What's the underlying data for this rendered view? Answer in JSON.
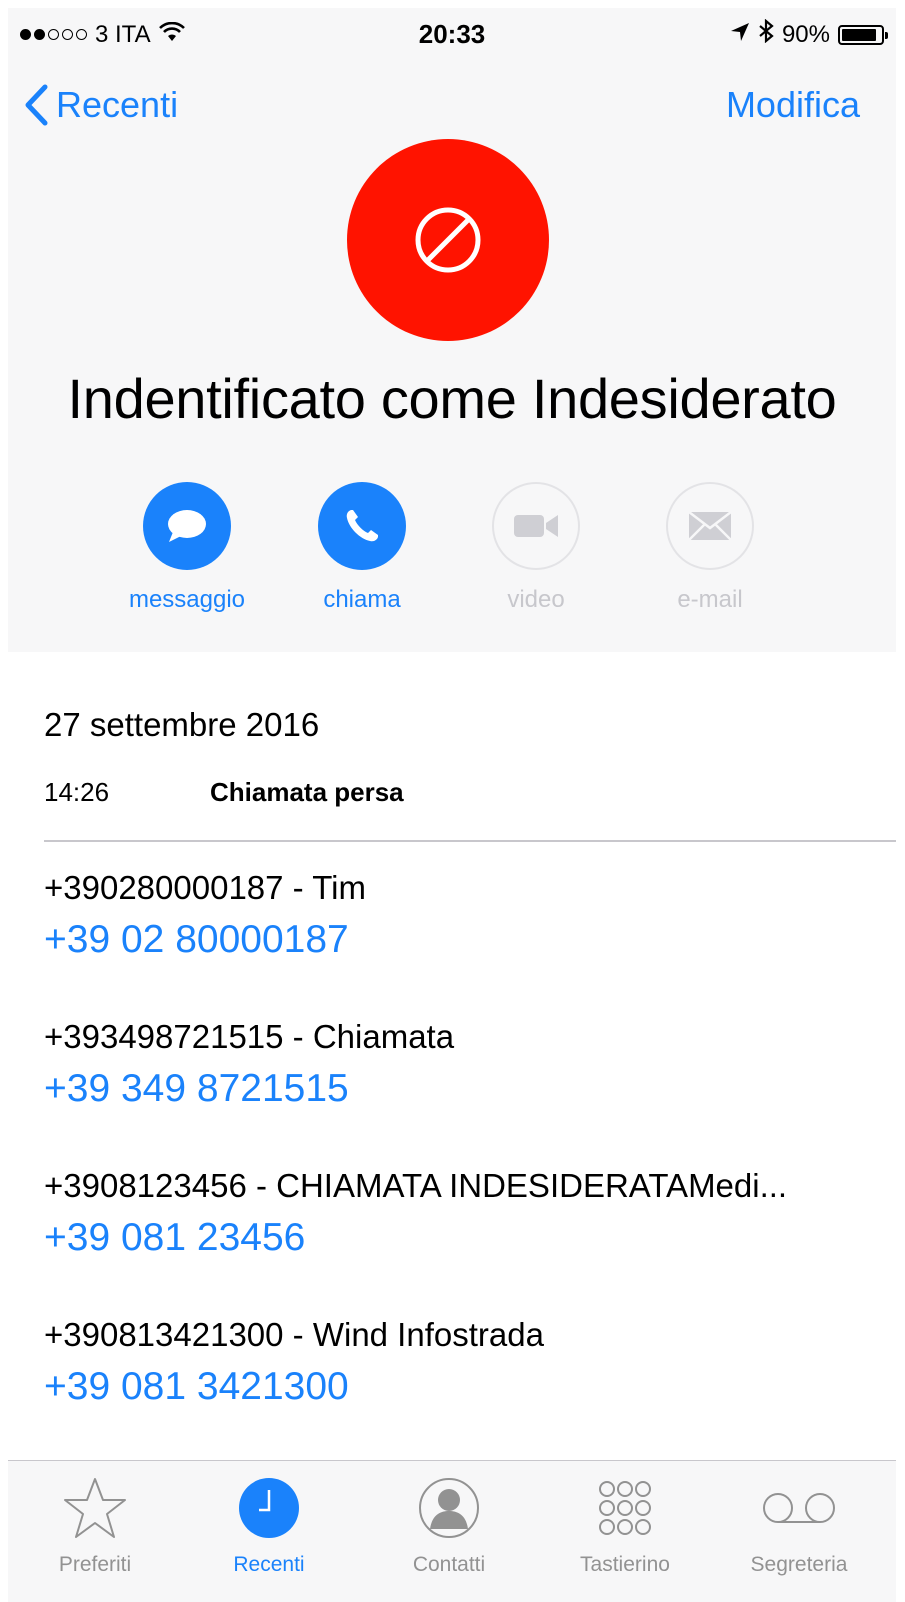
{
  "status_bar": {
    "carrier": "3 ITA",
    "time": "20:33",
    "battery": "90%",
    "battery_level": 0.9,
    "signal_bars": 2
  },
  "nav": {
    "back_label": "Recenti",
    "edit_label": "Modifica"
  },
  "contact": {
    "title": "Indentificato come Indesiderato",
    "avatar_color": "#ff1300",
    "avatar_icon": "blocked-icon"
  },
  "actions": [
    {
      "label": "messaggio",
      "icon": "message-icon",
      "enabled": true
    },
    {
      "label": "chiama",
      "icon": "phone-icon",
      "enabled": true
    },
    {
      "label": "video",
      "icon": "video-icon",
      "enabled": false
    },
    {
      "label": "e-mail",
      "icon": "mail-icon",
      "enabled": false
    }
  ],
  "call_log": {
    "date": "27 settembre 2016",
    "time": "14:26",
    "status": "Chiamata persa"
  },
  "phones": [
    {
      "name": "+390280000187 - Tim",
      "number": "+39 02 80000187"
    },
    {
      "name": "+393498721515 - Chiamata",
      "number": "+39 349 8721515"
    },
    {
      "name": "+3908123456 - CHIAMATA INDESIDERATAMedi...",
      "number": "+39 081 23456"
    },
    {
      "name": "+390813421300 - Wind Infostrada",
      "number": "+39 081 3421300"
    }
  ],
  "tabs": [
    {
      "label": "Preferiti",
      "icon": "star-icon",
      "active": false
    },
    {
      "label": "Recenti",
      "icon": "clock-icon",
      "active": true
    },
    {
      "label": "Contatti",
      "icon": "person-icon",
      "active": false
    },
    {
      "label": "Tastierino",
      "icon": "keypad-icon",
      "active": false
    },
    {
      "label": "Segreteria",
      "icon": "voicemail-icon",
      "active": false
    }
  ],
  "colors": {
    "accent": "#1a82fb",
    "inactive": "#929292",
    "disabled": "#c7c7cc"
  }
}
